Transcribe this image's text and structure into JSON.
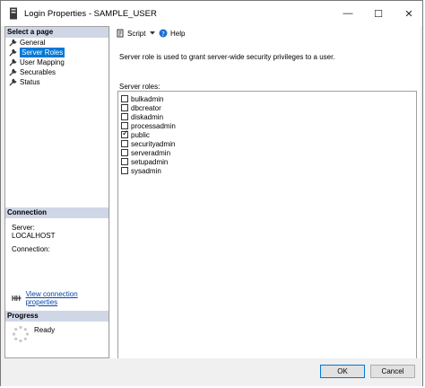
{
  "window": {
    "title": "Login Properties - SAMPLE_USER",
    "controls": {
      "minimize": "—",
      "maximize": "☐",
      "close": "✕"
    }
  },
  "left_panel": {
    "select_page": {
      "header": "Select a page",
      "items": [
        {
          "label": "General",
          "icon": "wrench-icon",
          "selected": false
        },
        {
          "label": "Server Roles",
          "icon": "wrench-icon",
          "selected": true
        },
        {
          "label": "User Mapping",
          "icon": "wrench-icon",
          "selected": false
        },
        {
          "label": "Securables",
          "icon": "wrench-icon",
          "selected": false
        },
        {
          "label": "Status",
          "icon": "wrench-icon",
          "selected": false
        }
      ]
    },
    "connection": {
      "header": "Connection",
      "server_label": "Server:",
      "server_value": "LOCALHOST",
      "connection_label": "Connection:",
      "view_link": "View connection properties",
      "link_icon": "connection-icon"
    },
    "progress": {
      "header": "Progress",
      "status": "Ready",
      "icon": "spinner-icon"
    }
  },
  "toolbar": {
    "script_label": "Script",
    "help_label": "Help"
  },
  "main": {
    "description": "Server role is used to grant server-wide security privileges to a user.",
    "roles_label": "Server roles:",
    "roles": [
      {
        "name": "bulkadmin",
        "checked": false
      },
      {
        "name": "dbcreator",
        "checked": false
      },
      {
        "name": "diskadmin",
        "checked": false
      },
      {
        "name": "processadmin",
        "checked": false
      },
      {
        "name": "public",
        "checked": true
      },
      {
        "name": "securityadmin",
        "checked": false
      },
      {
        "name": "serveradmin",
        "checked": false
      },
      {
        "name": "setupadmin",
        "checked": false
      },
      {
        "name": "sysadmin",
        "checked": false
      }
    ]
  },
  "buttons": {
    "ok": "OK",
    "cancel": "Cancel"
  },
  "colors": {
    "selection": "#0078d7",
    "panel_header": "#cfd6e6",
    "link": "#0645ad"
  }
}
